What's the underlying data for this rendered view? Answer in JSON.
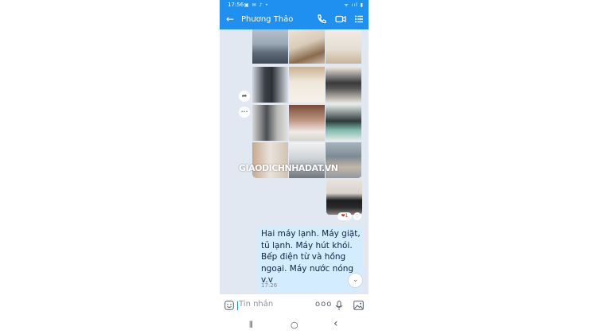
{
  "status_bar": {
    "time": "17:56",
    "notifications": "▣ ✉ ♪ •",
    "system": "ᯤ ııl ▮"
  },
  "header": {
    "back_glyph": "←",
    "contact_name": "Phương Thảo",
    "call_icon": "phone-icon",
    "video_icon": "video-icon",
    "menu_icon": "list-icon"
  },
  "chat": {
    "photo_grid_watermark": "GIAODICHNHADAT.VN",
    "side_actions": {
      "share": "➦",
      "more": "•••"
    },
    "reactions": {
      "heart_count": "❤1",
      "add_heart": "♡"
    },
    "message": {
      "text": "Hai máy lạnh. Máy giặt, tủ lạnh. Máy hút khói. Bếp điện từ và hồng ngoại. Máy nước nóng v.v",
      "time": "17:26"
    },
    "scroll_down_glyph": "⌄"
  },
  "input_bar": {
    "placeholder": "Tin nhắn",
    "more_glyph": "ooo"
  },
  "nav_bar": {
    "recents": "⦀",
    "home": "○",
    "back": "‹"
  },
  "colors": {
    "accent": "#1f8ff0",
    "chat_bg": "#e1e8f2",
    "bubble": "#d4ecff"
  }
}
